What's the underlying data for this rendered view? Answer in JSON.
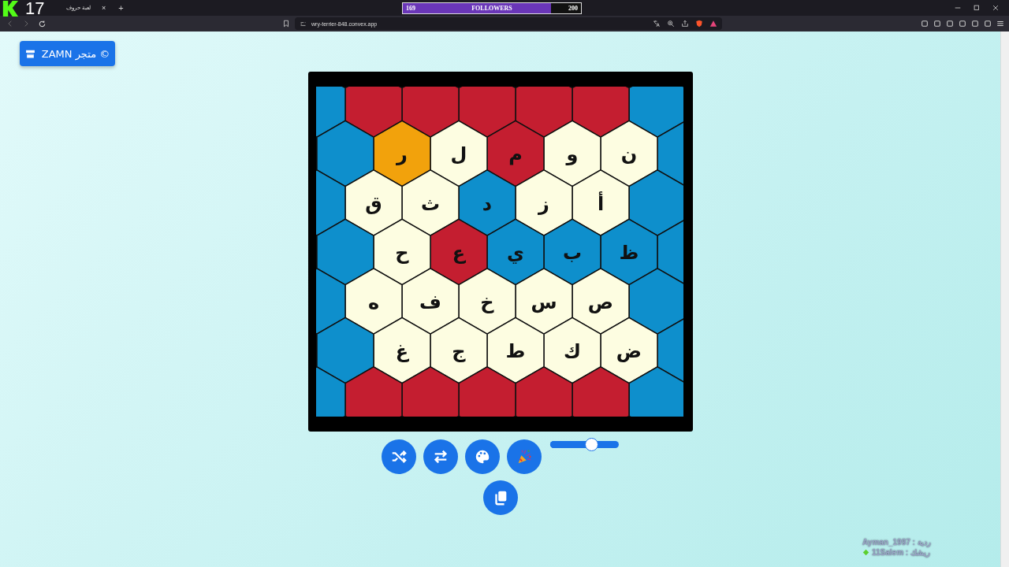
{
  "browser": {
    "counter": "17",
    "tab": {
      "title": "لعبة حروف",
      "close": "×"
    },
    "new_tab": "+",
    "followers": {
      "current": "169",
      "label": "FOLLOWERS",
      "goal": "200",
      "level": 0.83
    },
    "address": "wry-terrier-848.convex.app"
  },
  "store_button": {
    "label": "ZAMN متجر ©"
  },
  "board": {
    "rows": [
      [
        {
          "color": "#0e8fcc"
        },
        {
          "color": "#c41e30"
        },
        {
          "color": "#c41e30"
        },
        {
          "color": "#c41e30"
        },
        {
          "color": "#c41e30"
        },
        {
          "color": "#c41e30"
        },
        {
          "color": "#0e8fcc"
        }
      ],
      [
        {
          "color": "#0e8fcc"
        },
        {
          "letter": "ن",
          "color": "#fdfde1"
        },
        {
          "letter": "و",
          "color": "#fdfde1"
        },
        {
          "letter": "م",
          "color": "#c41e30"
        },
        {
          "letter": "ل",
          "color": "#fdfde1"
        },
        {
          "letter": "ر",
          "color": "#f2a20c"
        },
        {
          "color": "#0e8fcc"
        }
      ],
      [
        {
          "color": "#0e8fcc"
        },
        {
          "letter": "أ",
          "color": "#fdfde1"
        },
        {
          "letter": "ز",
          "color": "#fdfde1"
        },
        {
          "letter": "د",
          "color": "#0e8fcc"
        },
        {
          "letter": "ث",
          "color": "#fdfde1"
        },
        {
          "letter": "ق",
          "color": "#fdfde1"
        },
        {
          "color": "#0e8fcc"
        }
      ],
      [
        {
          "color": "#0e8fcc"
        },
        {
          "letter": "ظ",
          "color": "#0e8fcc"
        },
        {
          "letter": "ب",
          "color": "#0e8fcc"
        },
        {
          "letter": "ي",
          "color": "#0e8fcc"
        },
        {
          "letter": "ع",
          "color": "#c41e30"
        },
        {
          "letter": "ح",
          "color": "#fdfde1"
        },
        {
          "color": "#0e8fcc"
        }
      ],
      [
        {
          "color": "#0e8fcc"
        },
        {
          "letter": "ص",
          "color": "#fdfde1"
        },
        {
          "letter": "س",
          "color": "#fdfde1"
        },
        {
          "letter": "خ",
          "color": "#fdfde1"
        },
        {
          "letter": "ف",
          "color": "#fdfde1"
        },
        {
          "letter": "ه",
          "color": "#fdfde1"
        },
        {
          "color": "#0e8fcc"
        }
      ],
      [
        {
          "color": "#0e8fcc"
        },
        {
          "letter": "ض",
          "color": "#fdfde1"
        },
        {
          "letter": "ك",
          "color": "#fdfde1"
        },
        {
          "letter": "ط",
          "color": "#fdfde1"
        },
        {
          "letter": "ج",
          "color": "#fdfde1"
        },
        {
          "letter": "غ",
          "color": "#fdfde1"
        },
        {
          "color": "#0e8fcc"
        }
      ],
      [
        {
          "color": "#0e8fcc"
        },
        {
          "color": "#c41e30"
        },
        {
          "color": "#c41e30"
        },
        {
          "color": "#c41e30"
        },
        {
          "color": "#c41e30"
        },
        {
          "color": "#c41e30"
        },
        {
          "color": "#0e8fcc"
        }
      ]
    ]
  },
  "controls": {
    "buttons": [
      {
        "kind": "shuffle"
      },
      {
        "kind": "swap"
      },
      {
        "kind": "palette"
      },
      {
        "kind": "party"
      }
    ],
    "slider": {
      "level": 0.6
    },
    "copy_button": {
      "kind": "copy"
    }
  },
  "overlay": {
    "lines": [
      {
        "kind": "plain",
        "text": "Ayman_1997 : ردية"
      },
      {
        "kind": "diamond",
        "text": "11Salem : ريشك"
      }
    ]
  }
}
